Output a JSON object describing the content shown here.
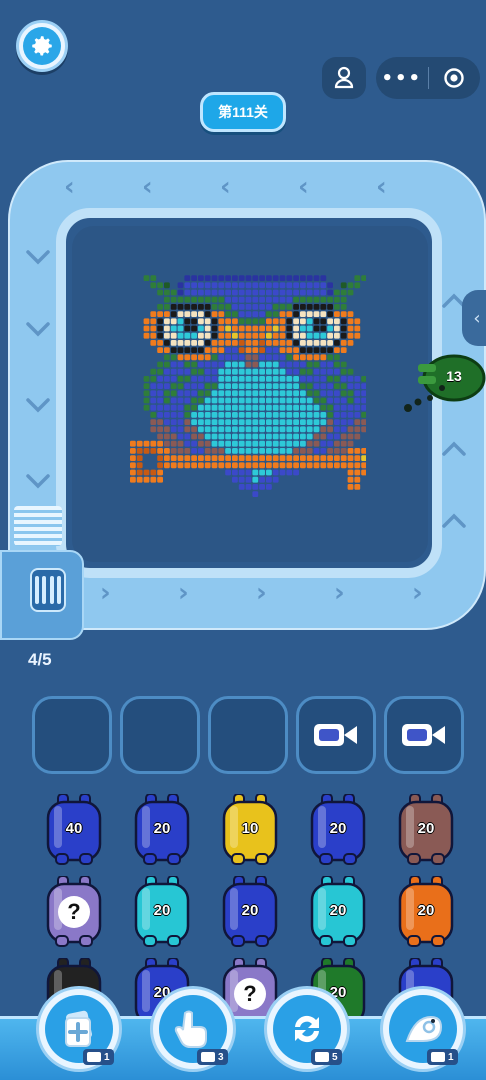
{
  "header": {
    "settings_icon": "gear-icon",
    "avatar_icon": "user-icon",
    "menu_dots": "•••",
    "level_label": "第111关"
  },
  "board": {
    "arrows": [
      "‹",
      "‹",
      "‹",
      "‹",
      "‹",
      "›",
      "›",
      "›",
      "›",
      "›"
    ],
    "conveyor_piece_count": "13",
    "side_tab_icon": "chevron-left-icon",
    "progress": "4/5"
  },
  "slots": [
    {
      "locked": false,
      "icon": ""
    },
    {
      "locked": false,
      "icon": ""
    },
    {
      "locked": false,
      "icon": ""
    },
    {
      "locked": true,
      "icon": "video-icon"
    },
    {
      "locked": true,
      "icon": "video-icon"
    }
  ],
  "jars": [
    {
      "label": "40",
      "color": "#2a3fc9"
    },
    {
      "label": "20",
      "color": "#2a3fc9"
    },
    {
      "label": "10",
      "color": "#e8c21c"
    },
    {
      "label": "20",
      "color": "#2a3fc9"
    },
    {
      "label": "20",
      "color": "#8a5a55"
    },
    {
      "label": "?",
      "color": "#8a78c8"
    },
    {
      "label": "20",
      "color": "#27c6d4"
    },
    {
      "label": "20",
      "color": "#2a3fc9"
    },
    {
      "label": "20",
      "color": "#27c6d4"
    },
    {
      "label": "20",
      "color": "#e96f1a"
    },
    {
      "label": "",
      "color": "#222222"
    },
    {
      "label": "20",
      "color": "#2a3fc9"
    },
    {
      "label": "?",
      "color": "#8a78c8"
    },
    {
      "label": "20",
      "color": "#1f7a2a"
    },
    {
      "label": "",
      "color": "#2a3fc9"
    }
  ],
  "tools": [
    {
      "name": "add-slot-tool",
      "icon": "add-card-icon",
      "count": "1"
    },
    {
      "name": "pick-tool",
      "icon": "pointing-hand-icon",
      "count": "3"
    },
    {
      "name": "shuffle-tool",
      "icon": "refresh-icon",
      "count": "5"
    },
    {
      "name": "magic-tool",
      "icon": "shell-icon",
      "count": "1"
    }
  ],
  "colors": {
    "background": "#2e5b8e",
    "accent": "#2aa6e8",
    "track": "#8fc8ef"
  }
}
